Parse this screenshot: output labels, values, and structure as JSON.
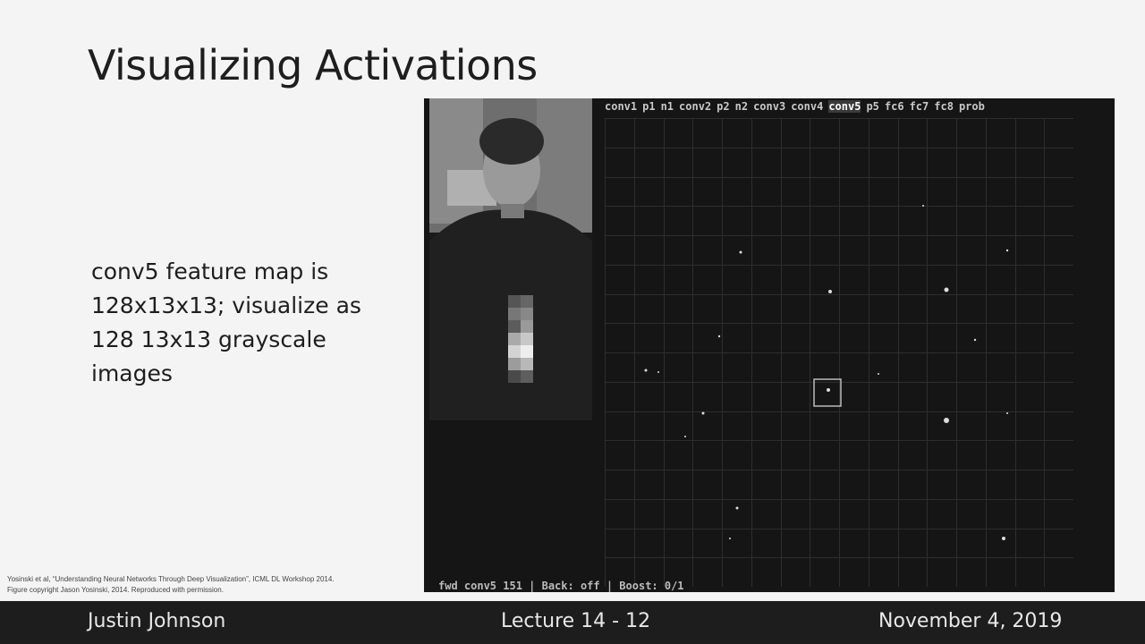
{
  "slide": {
    "title": "Visualizing Activations",
    "body_lines": [
      "conv5 feature map is",
      "128x13x13; visualize as",
      "128 13x13 grayscale",
      "images"
    ],
    "citation_line1": "Yosinski et al, “Understanding Neural Networks Through Deep Visualization”, ICML DL Workshop 2014.",
    "citation_line2": "Figure copyright Jason Yosinski, 2014. Reproduced with permission."
  },
  "tool": {
    "layers": [
      "conv1",
      "p1",
      "n1",
      "conv2",
      "p2",
      "n2",
      "conv3",
      "conv4",
      "conv5",
      "p5",
      "fc6",
      "fc7",
      "fc8",
      "prob"
    ],
    "active_layer": "conv5",
    "status_line": "fwd conv5 151 | Back: off | Boost: 0/1"
  },
  "footer": {
    "author": "Justin Johnson",
    "lecture": "Lecture 14 - 12",
    "date": "November 4, 2019"
  }
}
